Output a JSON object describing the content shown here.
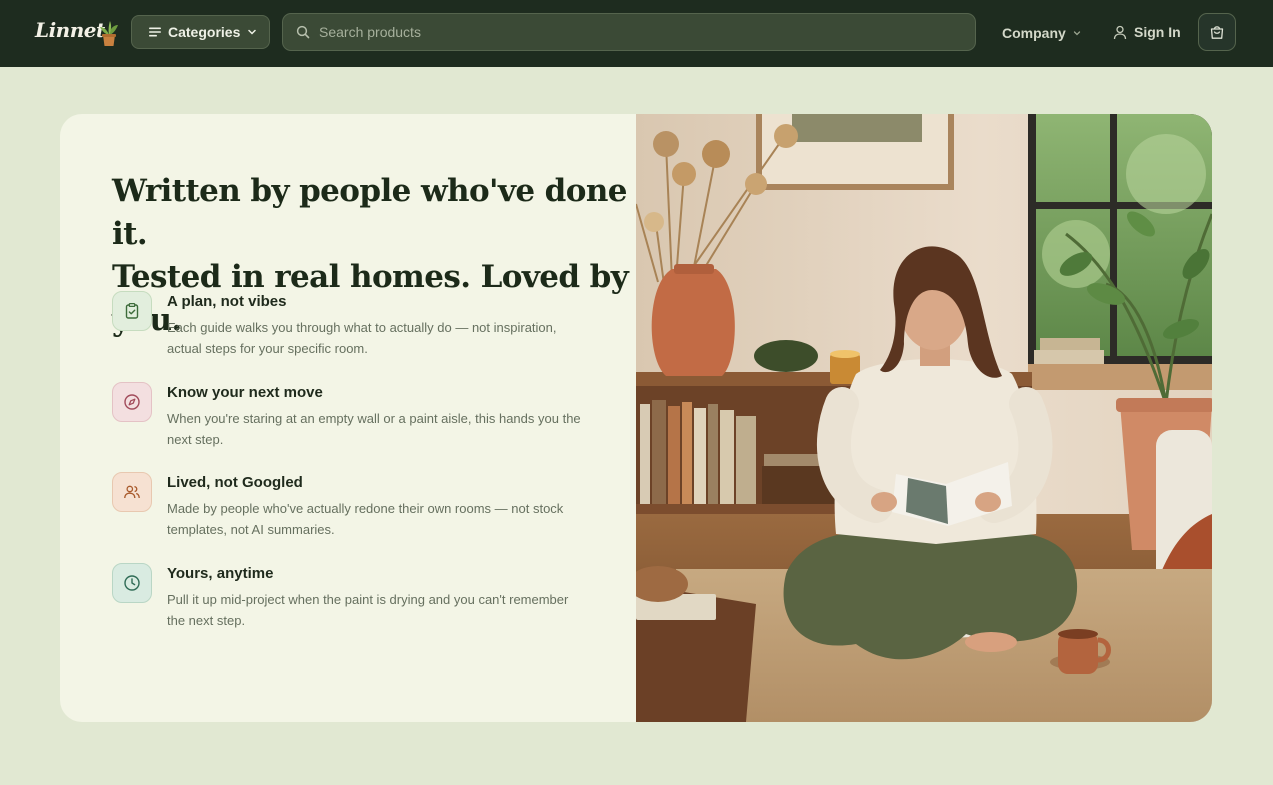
{
  "header": {
    "brand": "Linnet",
    "categories_label": "Categories",
    "search_placeholder": "Search products",
    "company_label": "Company",
    "signin_label": "Sign In"
  },
  "hero": {
    "headline_line1": "Written by people who've done it.",
    "headline_line2": "Tested in real homes. Loved by you.",
    "features": [
      {
        "icon": "clipboard-check-icon",
        "title": "A plan, not vibes",
        "description": "Each guide walks you through what to actually do — not inspiration, actual steps for your specific room."
      },
      {
        "icon": "compass-icon",
        "title": "Know your next move",
        "description": "When you're staring at an empty wall or a paint aisle, this hands you the next step."
      },
      {
        "icon": "users-icon",
        "title": "Lived, not Googled",
        "description": "Made by people who've actually redone their own rooms — not stock templates, not AI summaries."
      },
      {
        "icon": "clock-icon",
        "title": "Yours, anytime",
        "description": "Pull it up mid-project when the paint is drying and you can't remember the next step."
      }
    ]
  },
  "colors": {
    "header_bg": "#1e2c1f",
    "page_bg": "#e1e8d2",
    "card_bg": "#f3f5e6",
    "icon1_bg": "#e2eedd",
    "icon2_bg": "#f3dfe0",
    "icon3_bg": "#f6e1d2",
    "icon4_bg": "#d9ebe1"
  }
}
